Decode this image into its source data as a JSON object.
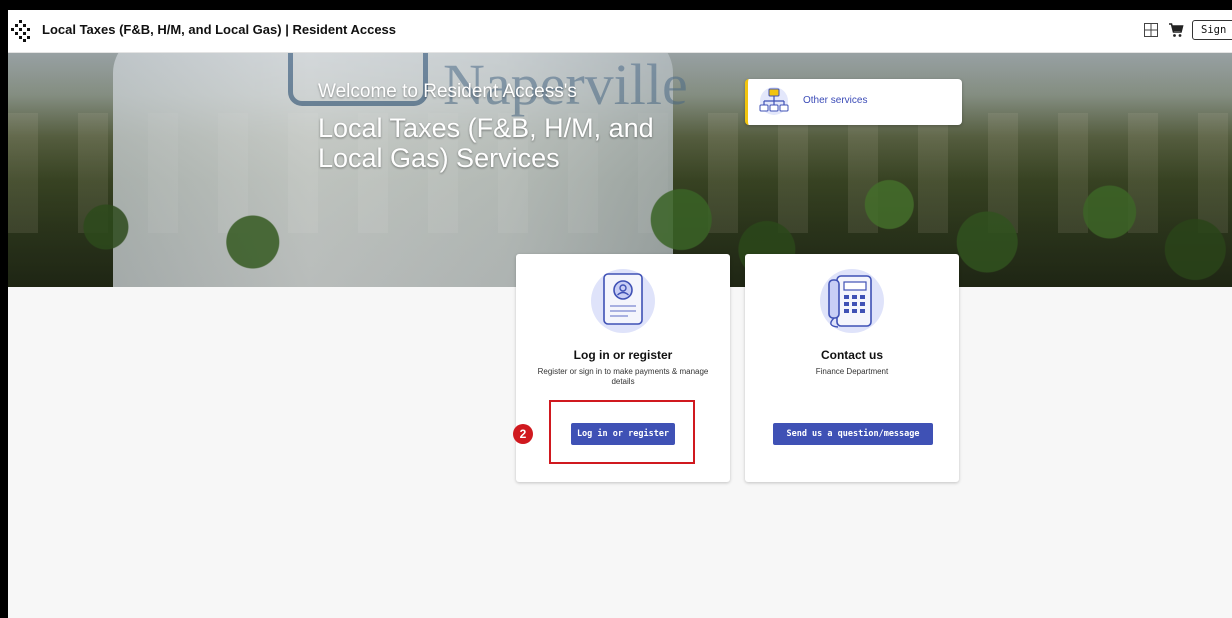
{
  "header": {
    "title": "Local Taxes (F&B, H/M, and Local Gas) | Resident Access",
    "sign_in_label": "Sign In"
  },
  "hero": {
    "welcome": "Welcome to Resident Access's",
    "title": "Local Taxes (F&B, H/M, and Local Gas) Services",
    "tower_word": "Naperville",
    "other_services_label": "Other services"
  },
  "cards": [
    {
      "title": "Log in or register",
      "description": "Register or sign in to make payments & manage details",
      "button_label": "Log in or register"
    },
    {
      "title": "Contact us",
      "description": "Finance Department",
      "button_label": "Send us a question/message"
    }
  ],
  "annotation": {
    "step": "2"
  },
  "colors": {
    "primary_button": "#3f51b5",
    "link": "#3b4bb7",
    "highlight": "#d0191f",
    "accent_border": "#f1c40f"
  },
  "icons": {
    "logo": "diamond-pattern-logo",
    "grid": "grid-icon",
    "cart": "cart-icon",
    "other_services": "sitemap-icon",
    "login_card": "id-badge-icon",
    "contact_card": "desk-phone-icon"
  }
}
